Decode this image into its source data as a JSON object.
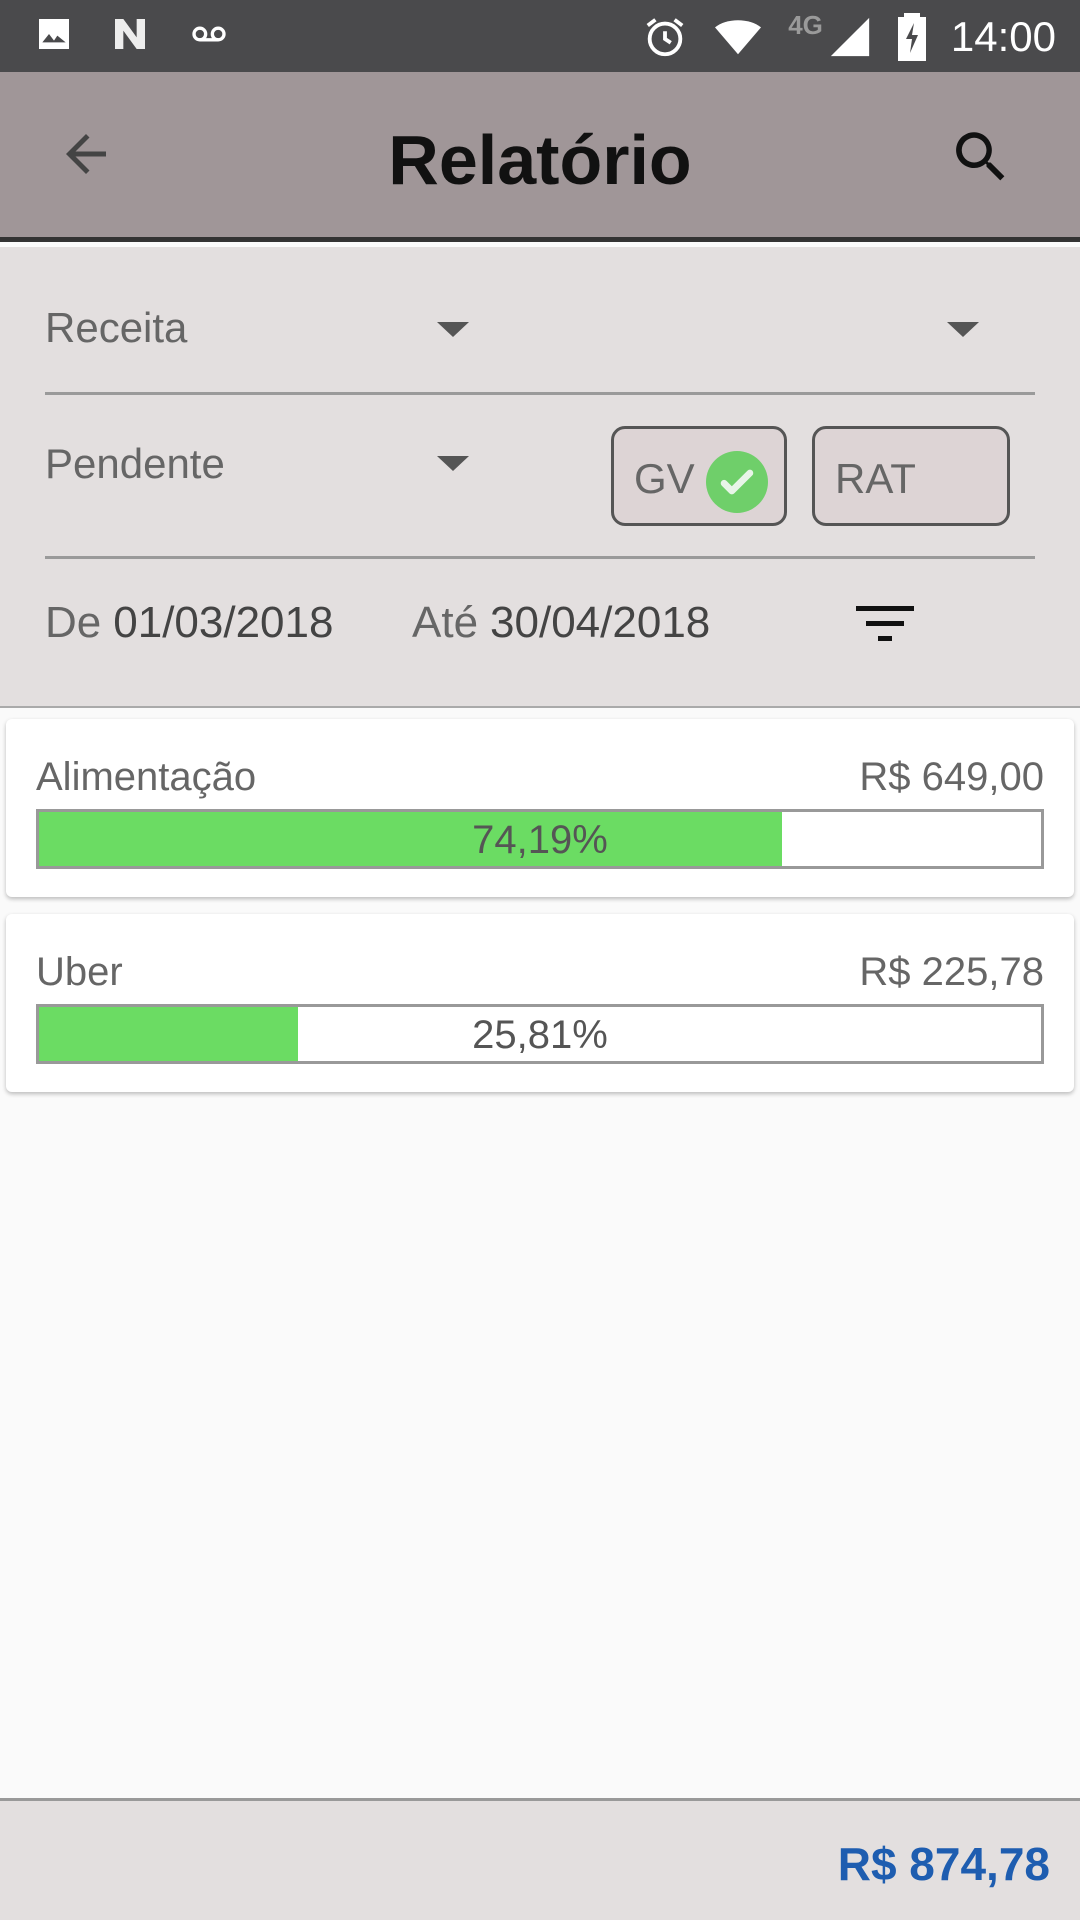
{
  "status_bar": {
    "time": "14:00",
    "network_label": "4G",
    "left_icons": [
      "image-icon",
      "n-notification-icon",
      "voicemail-icon"
    ],
    "right_icons": [
      "alarm-icon",
      "wifi-icon",
      "cell-signal-icon",
      "battery-charging-icon"
    ]
  },
  "app_bar": {
    "title": "Relatório",
    "back_icon": "arrow-back-icon",
    "search_icon": "search-icon"
  },
  "filters": {
    "type_select": {
      "value": "Receita"
    },
    "second_select": {
      "value": ""
    },
    "status_select": {
      "value": "Pendente"
    },
    "chips": [
      {
        "label": "GV",
        "checked": true
      },
      {
        "label": "RAT",
        "checked": false
      }
    ],
    "date_from_label": "De",
    "date_from": "01/03/2018",
    "date_to_label": "Até",
    "date_to": "30/04/2018",
    "filter_icon": "filter-list-icon"
  },
  "items": [
    {
      "name": "Alimentação",
      "amount": "R$ 649,00",
      "percent_label": "74,19%",
      "percent": 74.19
    },
    {
      "name": "Uber",
      "amount": "R$ 225,78",
      "percent_label": "25,81%",
      "percent": 25.81
    }
  ],
  "colors": {
    "app_bar": "#a09698",
    "progress_fill": "#6bdc63",
    "total_text": "#1e5db0"
  },
  "footer": {
    "total": "R$ 874,78"
  }
}
